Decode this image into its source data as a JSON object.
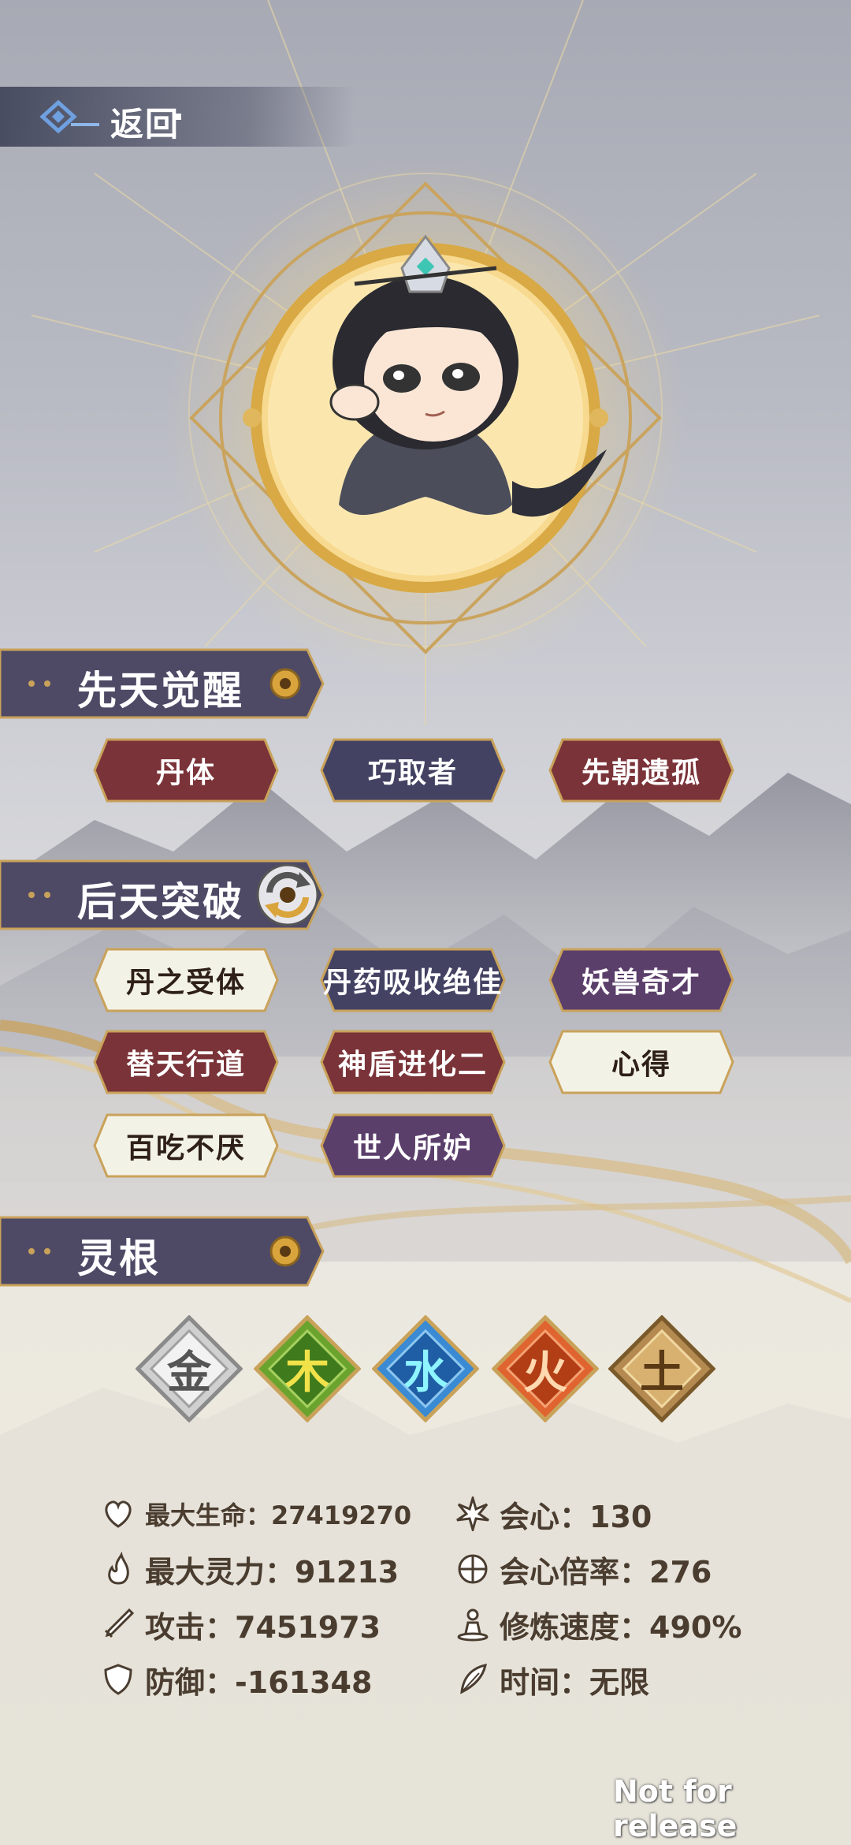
{
  "topbar": {
    "back_label": "返回"
  },
  "sections": {
    "innate": {
      "title": "先天觉醒"
    },
    "acquired": {
      "title": "后天突破"
    },
    "spirit_root": {
      "title": "灵根"
    }
  },
  "innate_tags": [
    {
      "label": "丹体",
      "style": "red"
    },
    {
      "label": "巧取者",
      "style": "navy"
    },
    {
      "label": "先朝遗孤",
      "style": "red"
    }
  ],
  "acquired_tags": [
    {
      "label": "丹之受体",
      "style": "cream"
    },
    {
      "label": "丹药吸收绝佳",
      "style": "navy"
    },
    {
      "label": "妖兽奇才",
      "style": "purple"
    },
    {
      "label": "替天行道",
      "style": "red"
    },
    {
      "label": "神盾进化二",
      "style": "red"
    },
    {
      "label": "心得",
      "style": "cream"
    },
    {
      "label": "百吃不厌",
      "style": "cream"
    },
    {
      "label": "世人所妒",
      "style": "purple"
    }
  ],
  "spirit_roots": [
    {
      "char": "金",
      "name": "metal",
      "color": "#9a9a9a"
    },
    {
      "char": "木",
      "name": "wood",
      "color": "#5a9a2a"
    },
    {
      "char": "水",
      "name": "water",
      "color": "#2a7ac4"
    },
    {
      "char": "火",
      "name": "fire",
      "color": "#d4562a"
    },
    {
      "char": "土",
      "name": "earth",
      "color": "#a88048"
    }
  ],
  "stats": {
    "max_hp": "最大生命：27419270",
    "max_spirit": "最大灵力：91213",
    "attack": "攻击：7451973",
    "defense": "防御：-161348",
    "crit": "会心：130",
    "crit_rate": "会心倍率：276",
    "cultivation_speed": "修炼速度：490%",
    "time": "时间：无限"
  },
  "watermark": "Not for release",
  "colors": {
    "tag_red": "#7a3338",
    "tag_navy": "#434263",
    "tag_purple": "#5b3f6b",
    "tag_cream": "#f3f2e6",
    "banner": "#4e4a66",
    "gold": "#c9a25a"
  }
}
